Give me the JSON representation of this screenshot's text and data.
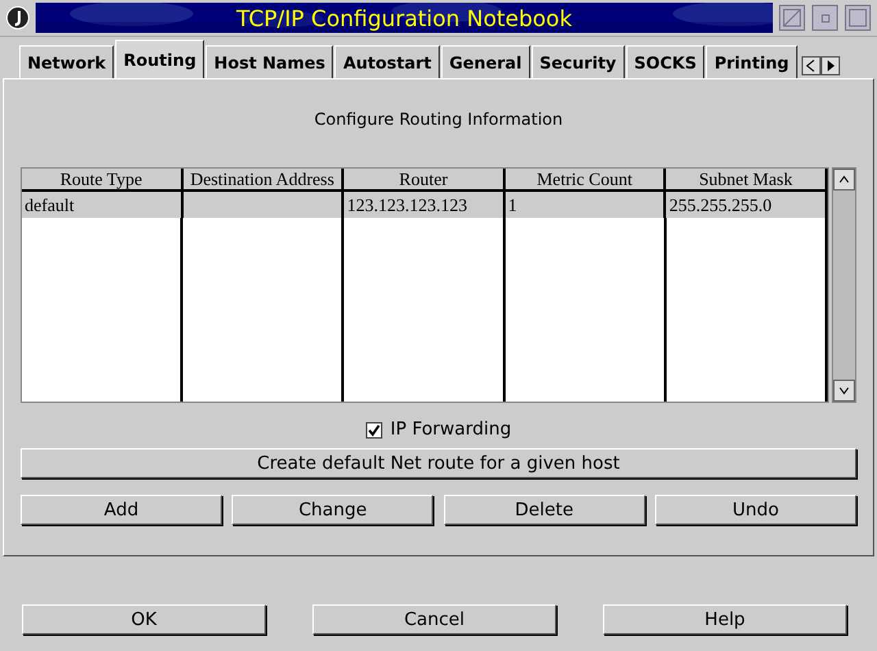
{
  "window": {
    "title": "TCP/IP Configuration Notebook"
  },
  "tabs": [
    {
      "label": "Network",
      "selected": false
    },
    {
      "label": "Routing",
      "selected": true
    },
    {
      "label": "Host Names",
      "selected": false
    },
    {
      "label": "Autostart",
      "selected": false
    },
    {
      "label": "General",
      "selected": false
    },
    {
      "label": "Security",
      "selected": false
    },
    {
      "label": "SOCKS",
      "selected": false
    },
    {
      "label": "Printing",
      "selected": false
    }
  ],
  "heading": "Configure Routing Information",
  "table": {
    "columns": [
      "Route Type",
      "Destination Address",
      "Router",
      "Metric Count",
      "Subnet Mask"
    ],
    "rows": [
      {
        "cells": [
          "default",
          "",
          "123.123.123.123",
          "1",
          "255.255.255.0"
        ],
        "selected": true
      }
    ]
  },
  "ip_forwarding": {
    "label": "IP Forwarding",
    "checked": true
  },
  "wide_button": "Create default Net route for a given host",
  "route_buttons": [
    "Add",
    "Change",
    "Delete",
    "Undo"
  ],
  "dialog_buttons": [
    "OK",
    "Cancel",
    "Help"
  ]
}
